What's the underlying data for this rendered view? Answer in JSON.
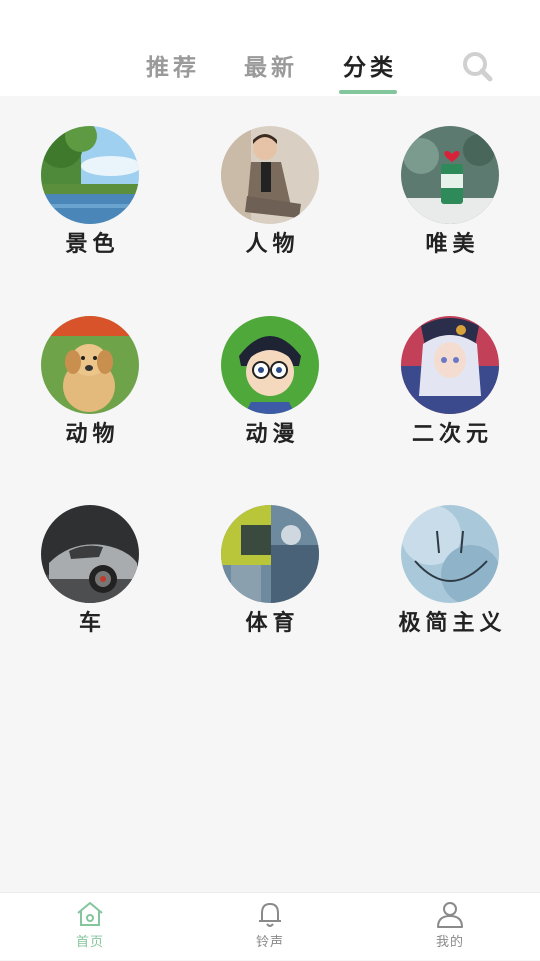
{
  "tabs": [
    {
      "label": "推荐",
      "active": false
    },
    {
      "label": "最新",
      "active": false
    },
    {
      "label": "分类",
      "active": true
    }
  ],
  "search_icon": "search-icon",
  "categories": [
    {
      "label": "景色"
    },
    {
      "label": "人物"
    },
    {
      "label": "唯美"
    },
    {
      "label": "动物"
    },
    {
      "label": "动漫"
    },
    {
      "label": "二次元"
    },
    {
      "label": "车"
    },
    {
      "label": "体育"
    },
    {
      "label": "极简主义"
    }
  ],
  "bottom_nav": [
    {
      "label": "首页",
      "icon": "home-icon",
      "active": true
    },
    {
      "label": "铃声",
      "icon": "bell-icon",
      "active": false
    },
    {
      "label": "我的",
      "icon": "user-icon",
      "active": false
    }
  ],
  "colors": {
    "accent": "#84c69b",
    "tab_inactive": "#9a9a9a",
    "tab_active": "#222222"
  }
}
